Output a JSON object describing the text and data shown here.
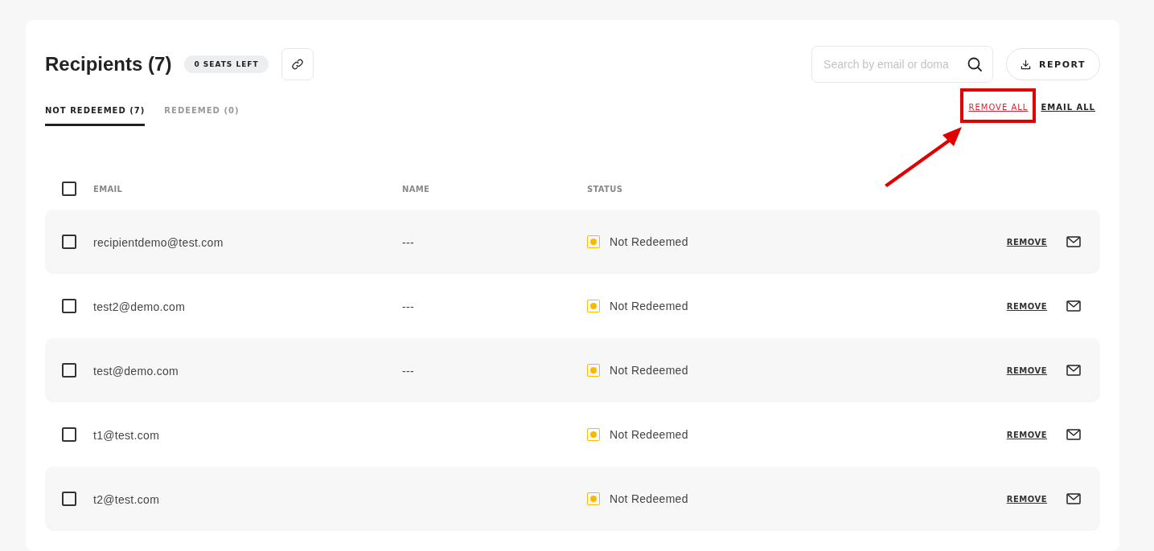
{
  "header": {
    "title": "Recipients (7)",
    "seats_badge": "0 SEATS LEFT"
  },
  "search": {
    "placeholder": "Search by email or doma"
  },
  "report_button": "REPORT",
  "tabs": [
    {
      "label": "NOT REDEEMED (7)",
      "selected": true
    },
    {
      "label": "REDEEMED (0)",
      "selected": false
    }
  ],
  "bulk_actions": [
    {
      "label": "REMOVE ALL",
      "kind": "danger",
      "highlighted": true
    },
    {
      "label": "EMAIL ALL",
      "kind": "normal",
      "highlighted": false
    }
  ],
  "table": {
    "select_all_checked": false,
    "columns": [
      "EMAIL",
      "NAME",
      "STATUS"
    ],
    "rows": [
      {
        "email": "recipientdemo@test.com",
        "name": "---",
        "status": "Not Redeemed",
        "color": "#ffb800",
        "checked": false,
        "action": "REMOVE"
      },
      {
        "email": "test2@demo.com",
        "name": "---",
        "status": "Not Redeemed",
        "color": "#ffb800",
        "checked": false,
        "action": "REMOVE"
      },
      {
        "email": "test@demo.com",
        "name": "---",
        "status": "Not Redeemed",
        "color": "#ffb800",
        "checked": false,
        "action": "REMOVE"
      },
      {
        "email": "t1@test.com",
        "status": "Not Redeemed",
        "color": "#ffb800",
        "checked": false,
        "action": "REMOVE"
      },
      {
        "email": "t2@test.com",
        "status": "Not Redeemed",
        "color": "#ffb800",
        "checked": false,
        "action": "REMOVE"
      }
    ]
  }
}
